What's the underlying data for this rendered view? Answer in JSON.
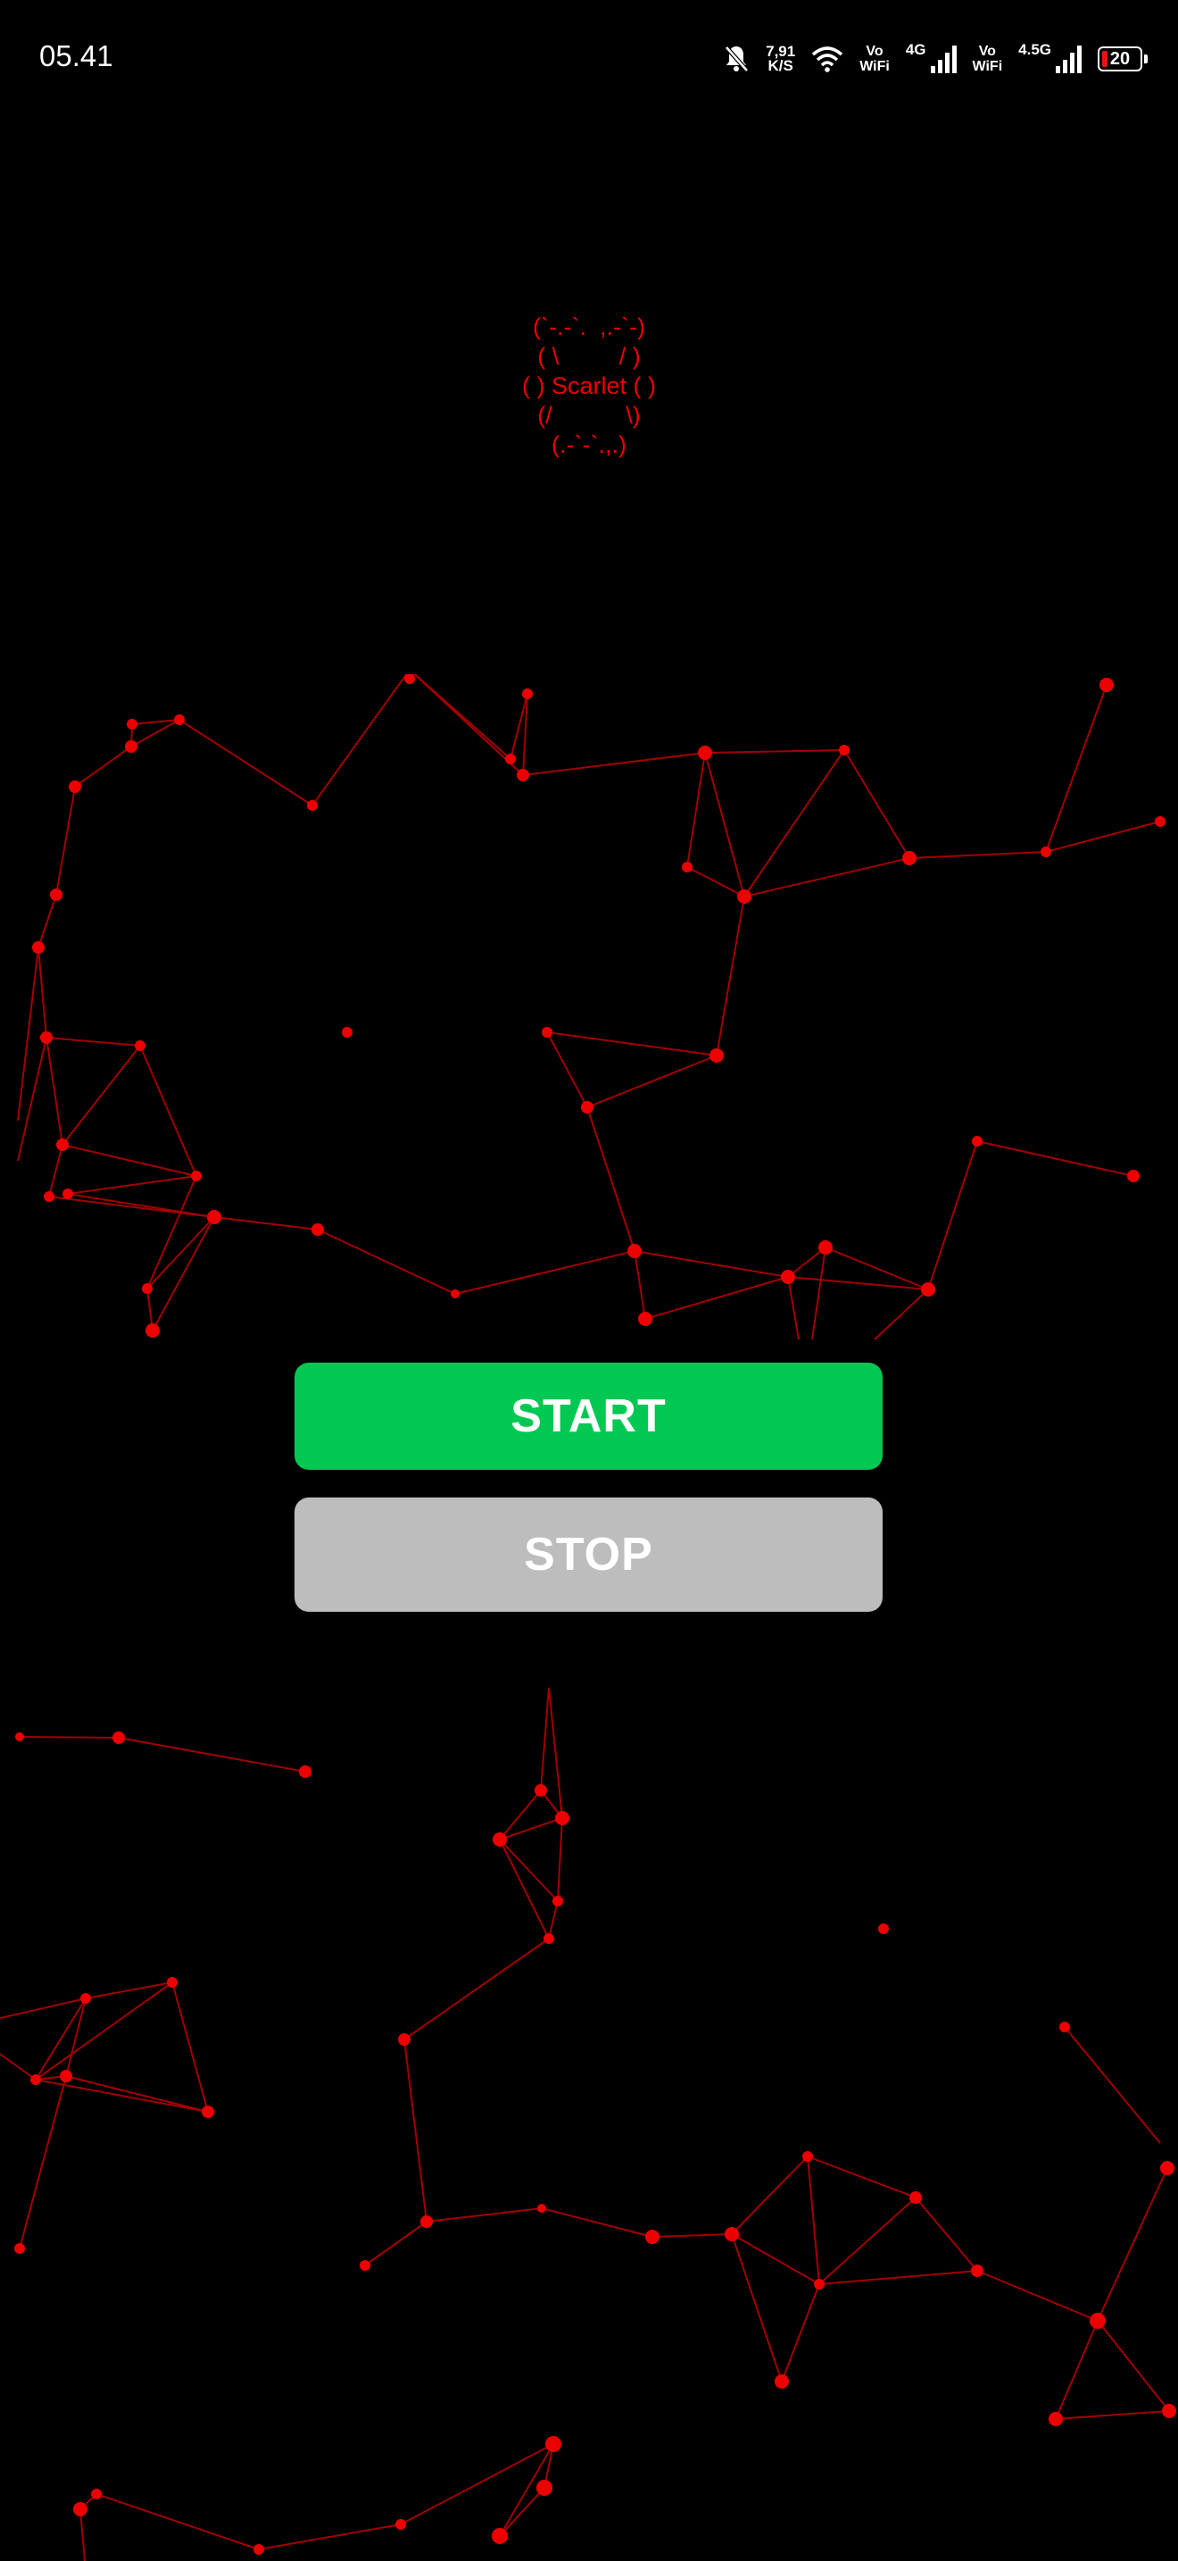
{
  "status_bar": {
    "time": "05.41",
    "net_speed_value": "7,91",
    "net_speed_unit": "K/S",
    "vowifi_1_top": "Vo",
    "vowifi_1_bottom": "WiFi",
    "net_type_1": "4G",
    "vowifi_2_top": "Vo",
    "vowifi_2_bottom": "WiFi",
    "net_type_2": "4.5G",
    "battery_level": "20",
    "icons": [
      "bell-muted-icon",
      "wifi-icon",
      "signal-icon",
      "signal-icon",
      "battery-icon"
    ]
  },
  "logo": {
    "ascii_art": "(`-.-`.  ,.-`-)\n( \\         / )\n( ) Scarlet ( )\n(/           \\)\n(.-`-`.,.)",
    "color": "#e00000"
  },
  "buttons": {
    "start_label": "START",
    "stop_label": "STOP",
    "start_color": "#00c853",
    "stop_color": "#bdbdbd"
  },
  "background": {
    "color": "#000000",
    "network_color": "#e00000"
  }
}
